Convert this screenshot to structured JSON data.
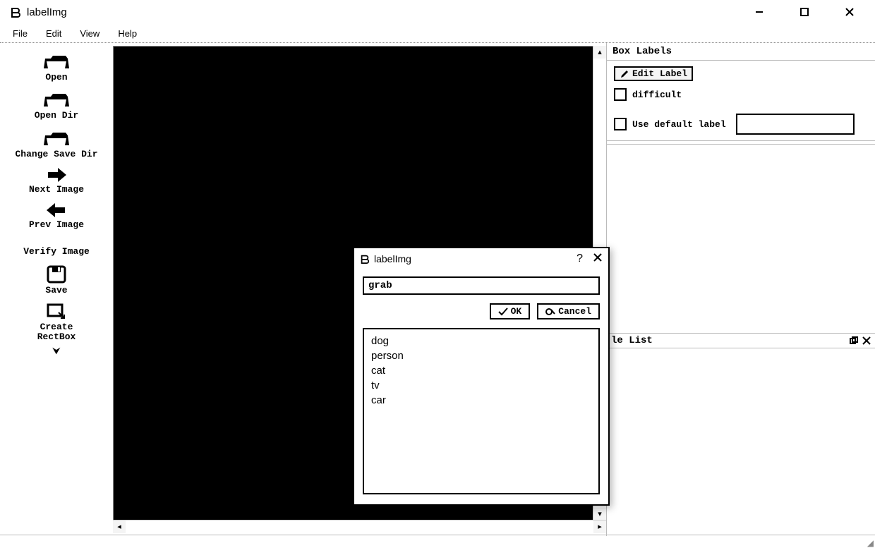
{
  "title": "labelImg",
  "menubar": {
    "file": "File",
    "edit": "Edit",
    "view": "View",
    "help": "Help"
  },
  "sidebar": {
    "open": "Open",
    "open_dir": "Open Dir",
    "change_save_dir": "Change Save Dir",
    "next_image": "Next Image",
    "prev_image": "Prev Image",
    "verify_image": "Verify Image",
    "save": "Save",
    "create_rectbox": "Create\nRectBox"
  },
  "right": {
    "box_labels_title": "Box Labels",
    "edit_label_btn": "Edit Label",
    "difficult_label": "difficult",
    "use_default_label": "Use default label",
    "default_label_value": "",
    "file_list_title": "le List"
  },
  "dialog": {
    "title": "labelImg",
    "input_value": "grab",
    "ok": "OK",
    "cancel": "Cancel",
    "options": [
      "dog",
      "person",
      "cat",
      "tv",
      "car"
    ]
  }
}
